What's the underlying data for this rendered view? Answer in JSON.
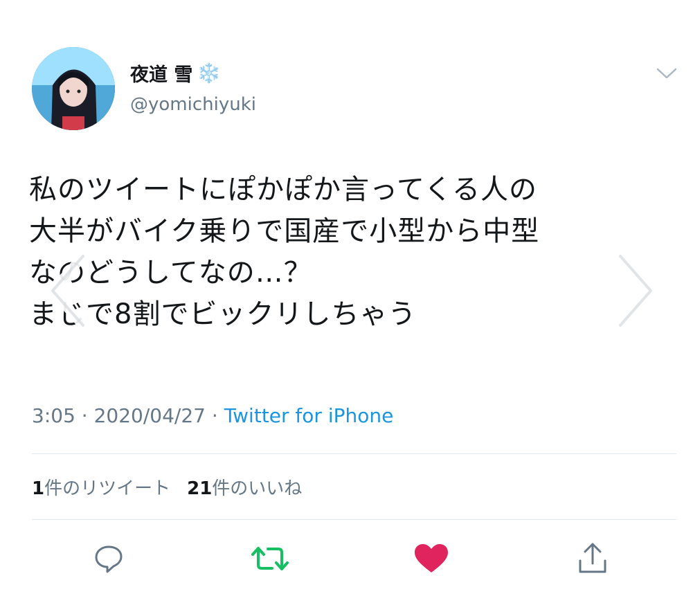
{
  "user": {
    "display_name": "夜道 雪",
    "name_emoji": "❄️",
    "handle": "@yomichiyuki"
  },
  "tweet": {
    "lines": [
      "私のツイートにぽかぽか言ってくる人の",
      "大半がバイク乗りで国産で小型から中型",
      "なのどうしてなの…？",
      "まじで8割でビックリしちゃう"
    ],
    "time": "3:05",
    "date": "2020/04/27",
    "separator": " · ",
    "source": "Twitter for iPhone"
  },
  "stats": {
    "retweet_count": "1",
    "retweet_label": "件のリツイート",
    "like_count": "21",
    "like_label": "件のいいね"
  },
  "icons": {
    "reply": "reply-icon",
    "retweet": "retweet-icon",
    "like": "heart-icon",
    "share": "share-icon",
    "menu": "chevron-down-icon"
  },
  "colors": {
    "retweet": "#17bf63",
    "like": "#e0245e",
    "link": "#1b95e0",
    "muted": "#657786"
  }
}
